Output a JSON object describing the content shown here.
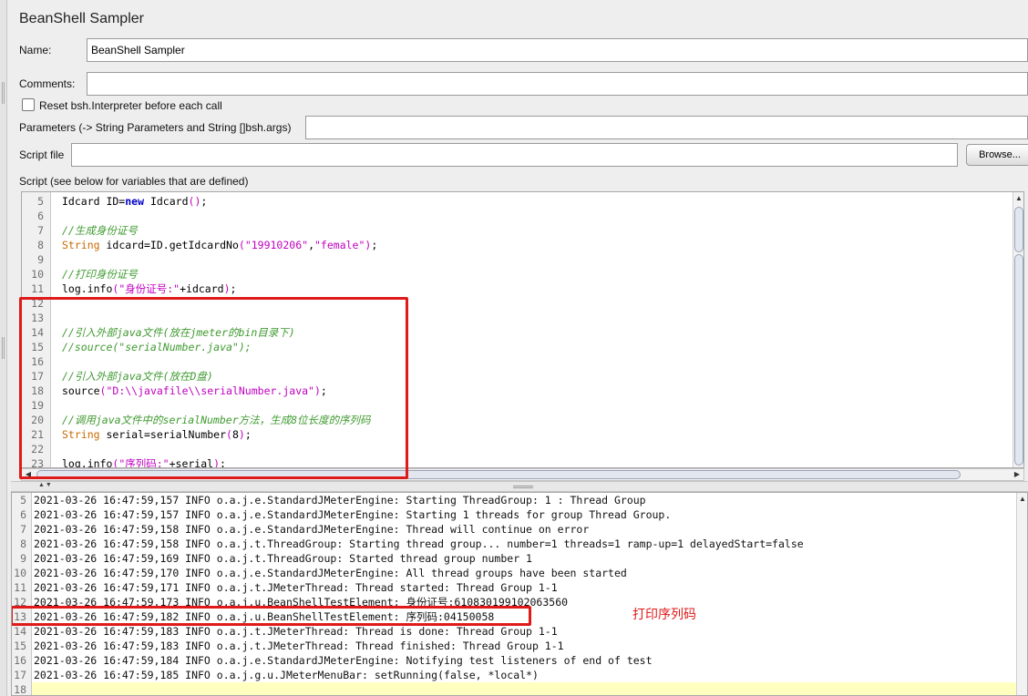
{
  "panel": {
    "title": "BeanShell Sampler",
    "name_label": "Name:",
    "name_value": "BeanShell Sampler",
    "comments_label": "Comments:",
    "comments_value": "",
    "reset_label": "Reset bsh.Interpreter before each call",
    "parameters_label": "Parameters (-> String Parameters and String []bsh.args)",
    "parameters_value": "",
    "scriptfile_label": "Script file",
    "scriptfile_value": "",
    "browse_label": "Browse...",
    "script_label": "Script (see below for variables that are defined)"
  },
  "script_lines": [
    {
      "n": "5",
      "text": "Idcard ID=new Idcard();"
    },
    {
      "n": "6",
      "text": ""
    },
    {
      "n": "7",
      "text": "//生成身份证号"
    },
    {
      "n": "8",
      "text": "String idcard=ID.getIdcardNo(\"19910206\",\"female\");"
    },
    {
      "n": "9",
      "text": ""
    },
    {
      "n": "10",
      "text": "//打印身份证号"
    },
    {
      "n": "11",
      "text": "log.info(\"身份证号:\"+idcard);"
    },
    {
      "n": "12",
      "text": ""
    },
    {
      "n": "13",
      "text": ""
    },
    {
      "n": "14",
      "text": "//引入外部java文件(放在jmeter的bin目录下)"
    },
    {
      "n": "15",
      "text": "//source(\"serialNumber.java\");"
    },
    {
      "n": "16",
      "text": ""
    },
    {
      "n": "17",
      "text": "//引入外部java文件(放在D盘)"
    },
    {
      "n": "18",
      "text": "source(\"D:\\\\javafile\\\\serialNumber.java\");"
    },
    {
      "n": "19",
      "text": ""
    },
    {
      "n": "20",
      "text": "//调用java文件中的serialNumber方法，生成8位长度的序列码"
    },
    {
      "n": "21",
      "text": "String serial=serialNumber(8);"
    },
    {
      "n": "22",
      "text": ""
    },
    {
      "n": "23",
      "text": "log.info(\"序列码:\"+serial);"
    }
  ],
  "log_lines": [
    {
      "n": "5",
      "text": "2021-03-26 16:47:59,157 INFO o.a.j.e.StandardJMeterEngine: Starting ThreadGroup: 1 : Thread Group"
    },
    {
      "n": "6",
      "text": "2021-03-26 16:47:59,157 INFO o.a.j.e.StandardJMeterEngine: Starting 1 threads for group Thread Group."
    },
    {
      "n": "7",
      "text": "2021-03-26 16:47:59,158 INFO o.a.j.e.StandardJMeterEngine: Thread will continue on error"
    },
    {
      "n": "8",
      "text": "2021-03-26 16:47:59,158 INFO o.a.j.t.ThreadGroup: Starting thread group... number=1 threads=1 ramp-up=1 delayedStart=false"
    },
    {
      "n": "9",
      "text": "2021-03-26 16:47:59,169 INFO o.a.j.t.ThreadGroup: Started thread group number 1"
    },
    {
      "n": "10",
      "text": "2021-03-26 16:47:59,170 INFO o.a.j.e.StandardJMeterEngine: All thread groups have been started"
    },
    {
      "n": "11",
      "text": "2021-03-26 16:47:59,171 INFO o.a.j.t.JMeterThread: Thread started: Thread Group 1-1"
    },
    {
      "n": "12",
      "text": "2021-03-26 16:47:59,173 INFO o.a.j.u.BeanShellTestElement: 身份证号:610830199102063560"
    },
    {
      "n": "13",
      "text": "2021-03-26 16:47:59,182 INFO o.a.j.u.BeanShellTestElement: 序列码:04150058"
    },
    {
      "n": "14",
      "text": "2021-03-26 16:47:59,183 INFO o.a.j.t.JMeterThread: Thread is done: Thread Group 1-1"
    },
    {
      "n": "15",
      "text": "2021-03-26 16:47:59,183 INFO o.a.j.t.JMeterThread: Thread finished: Thread Group 1-1"
    },
    {
      "n": "16",
      "text": "2021-03-26 16:47:59,184 INFO o.a.j.e.StandardJMeterEngine: Notifying test listeners of end of test"
    },
    {
      "n": "17",
      "text": "2021-03-26 16:47:59,185 INFO o.a.j.g.u.JMeterMenuBar: setRunning(false, *local*)"
    },
    {
      "n": "18",
      "text": ""
    }
  ],
  "annotation": "打印序列码",
  "colors": {
    "comment": "#3f9a30",
    "string": "#c000c0",
    "type": "#c96a00",
    "highlight_box": "#e01919",
    "cursor_line": "#ffffc0"
  }
}
